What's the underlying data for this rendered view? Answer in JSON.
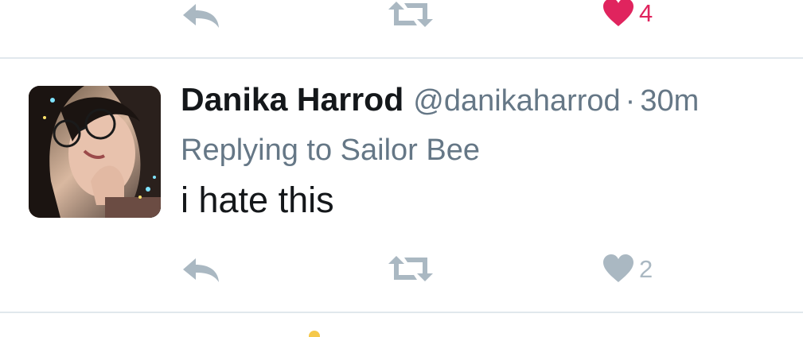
{
  "top_actions": {
    "like_count": "4",
    "like_color": "#e0245e",
    "icon_color": "#aab8c2",
    "reply_icon": "reply-icon",
    "retweet_icon": "retweet-icon",
    "like_icon": "heart-icon"
  },
  "tweet": {
    "author_name": "Danika Harrod",
    "handle": "@danikaharrod",
    "separator": "·",
    "time": "30m",
    "replying_to": "Replying to Sailor Bee",
    "text": "i hate this",
    "actions": {
      "like_count": "2",
      "reply_icon": "reply-icon",
      "retweet_icon": "retweet-icon",
      "like_icon": "heart-icon"
    }
  },
  "colors": {
    "text_primary": "#14171a",
    "text_secondary": "#657786",
    "divider": "#e1e8ed",
    "icon_gray": "#aab8c2",
    "liked_red": "#e0245e"
  }
}
